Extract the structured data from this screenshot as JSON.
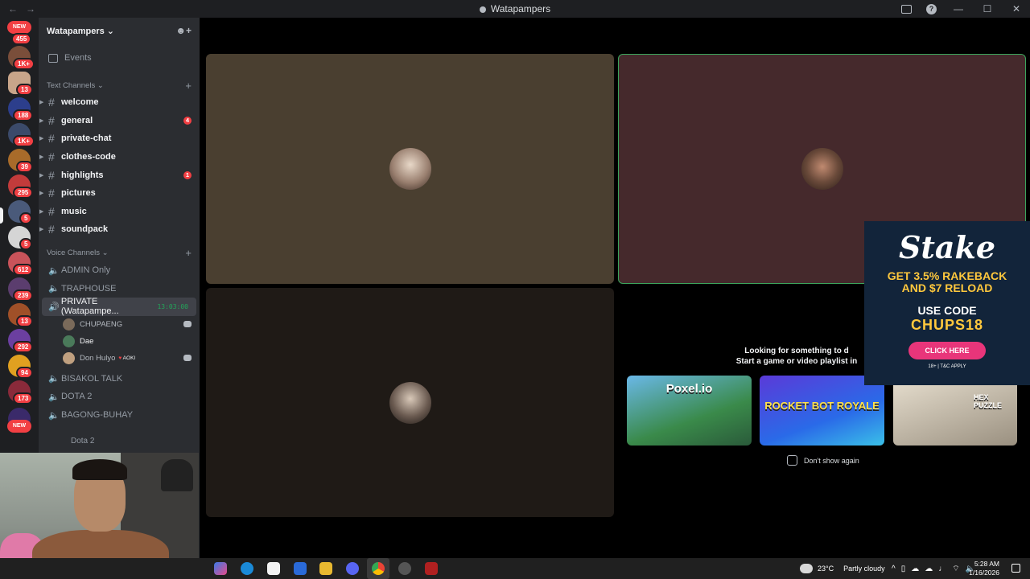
{
  "window": {
    "title": "Watapampers",
    "back": "←",
    "forward": "→",
    "help": "?",
    "minimize": "—",
    "close": "✕"
  },
  "rail": {
    "new_top": "NEW",
    "new_bottom": "NEW",
    "badges": [
      "455",
      "1K+",
      "13",
      "188",
      "1K+",
      "39",
      "295",
      "5",
      "5",
      "612",
      "239",
      "13",
      "292",
      "94",
      "173"
    ]
  },
  "server": {
    "name": "Watapampers",
    "chevron": "⌄",
    "invite_icon": "add-member-icon"
  },
  "sidebar": {
    "events_label": "Events",
    "text_category": "Text Channels",
    "voice_category": "Voice Channels",
    "text_channels": [
      {
        "name": "welcome",
        "unread": ""
      },
      {
        "name": "general",
        "unread": "4"
      },
      {
        "name": "private-chat",
        "unread": ""
      },
      {
        "name": "clothes-code",
        "unread": ""
      },
      {
        "name": "highlights",
        "unread": "1"
      },
      {
        "name": "pictures",
        "unread": ""
      },
      {
        "name": "music",
        "unread": ""
      },
      {
        "name": "soundpack",
        "unread": ""
      }
    ],
    "voice_channels_top": [
      "ADMIN Only",
      "TRAPHOUSE"
    ],
    "active_voice": {
      "name": "PRIVATE (Watapampe...",
      "timer": "13:03:00"
    },
    "members": [
      {
        "name": "CHUPAENG",
        "tag": ""
      },
      {
        "name": "Dae",
        "tag": ""
      },
      {
        "name": "Don Hulyo",
        "tag": "AOKI"
      }
    ],
    "voice_channels_bottom": [
      "BISAKOL TALK",
      "DOTA 2",
      "BAGONG-BUHAY"
    ],
    "partial_item": "Dota 2"
  },
  "activity": {
    "line1": "Looking for something to d",
    "line2": "Start a game or video playlist in",
    "games": [
      "Poxel.io",
      "ROCKET BOT ROYALE",
      "HEX PUZZLE"
    ],
    "dont_show": "Don't show again"
  },
  "ad": {
    "brand": "Stake",
    "line1": "GET 3.5% RAKEBACK",
    "line2": "AND $7 RELOAD",
    "line3": "USE CODE",
    "code": "CHUPS18",
    "button": "CLICK HERE",
    "fine": "18+ | T&C APPLY"
  },
  "taskbar": {
    "weather_temp": "23°C",
    "weather_desc": "Partly cloudy",
    "time": "5:28 AM",
    "date": "1/16/2026"
  },
  "colors": {
    "tile1": "#4a3f30",
    "tile2": "#45292c",
    "tile3": "#1f1a16",
    "speaking_border": "#3ba55c",
    "accent_red": "#f23f43"
  }
}
